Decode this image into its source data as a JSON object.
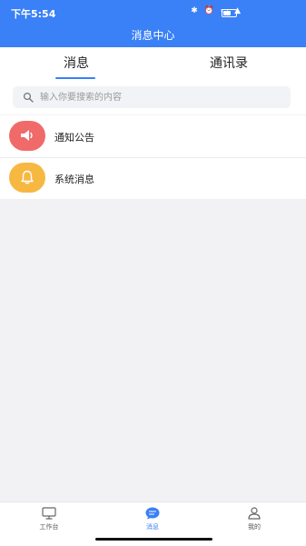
{
  "status_bar": {
    "time": "下午5:54",
    "icons": "✱ ⏰ ▭ ▲",
    "battery_level": 0.65
  },
  "header": {
    "title": "消息中心"
  },
  "tabs": [
    {
      "label": "消息",
      "active": true
    },
    {
      "label": "通讯录",
      "active": false
    }
  ],
  "search": {
    "placeholder": "输入你要搜索的内容"
  },
  "message_list": [
    {
      "label": "通知公告",
      "icon": "megaphone-icon",
      "color": "#f06a6a"
    },
    {
      "label": "系统消息",
      "icon": "bell-icon",
      "color": "#f7b842"
    }
  ],
  "bottom_nav": [
    {
      "label": "工作台",
      "icon": "monitor-icon",
      "active": false
    },
    {
      "label": "消息",
      "icon": "chat-icon",
      "active": true
    },
    {
      "label": "我的",
      "icon": "user-icon",
      "active": false
    }
  ],
  "colors": {
    "accent": "#3a80f6",
    "background": "#f2f2f4"
  }
}
